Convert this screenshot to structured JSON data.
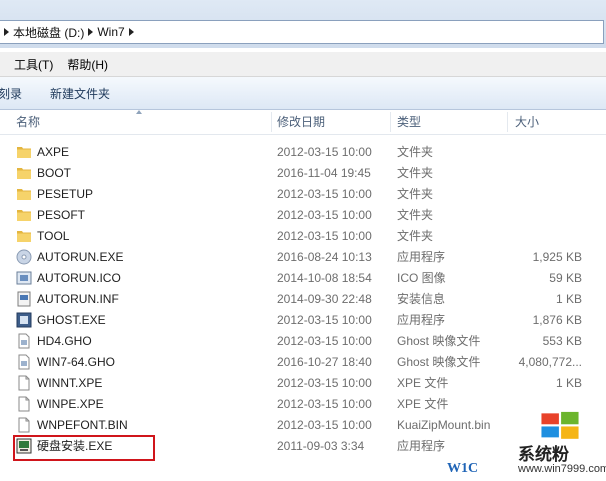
{
  "address": {
    "crumbs": [
      "本地磁盘 (D:)",
      "Win7"
    ]
  },
  "menu": [
    {
      "label": "工具(T)"
    },
    {
      "label": "帮助(H)"
    }
  ],
  "toolbar": {
    "burn_label": "刻录",
    "new_folder_label": "新建文件夹"
  },
  "columns": {
    "name": "名称",
    "date": "修改日期",
    "type": "类型",
    "size": "大小"
  },
  "files": [
    {
      "name": "AXPE",
      "date": "2012-03-15 10:00",
      "type": "文件夹",
      "size": "",
      "icon": "folder-icon"
    },
    {
      "name": "BOOT",
      "date": "2016-11-04 19:45",
      "type": "文件夹",
      "size": "",
      "icon": "folder-icon"
    },
    {
      "name": "PESETUP",
      "date": "2012-03-15 10:00",
      "type": "文件夹",
      "size": "",
      "icon": "folder-icon"
    },
    {
      "name": "PESOFT",
      "date": "2012-03-15 10:00",
      "type": "文件夹",
      "size": "",
      "icon": "folder-icon"
    },
    {
      "name": "TOOL",
      "date": "2012-03-15 10:00",
      "type": "文件夹",
      "size": "",
      "icon": "folder-icon"
    },
    {
      "name": "AUTORUN.EXE",
      "date": "2016-08-24 10:13",
      "type": "应用程序",
      "size": "1,925 KB",
      "icon": "disc-app-icon"
    },
    {
      "name": "AUTORUN.ICO",
      "date": "2014-10-08 18:54",
      "type": "ICO 图像",
      "size": "59 KB",
      "icon": "ico-image-icon"
    },
    {
      "name": "AUTORUN.INF",
      "date": "2014-09-30 22:48",
      "type": "安装信息",
      "size": "1 KB",
      "icon": "setup-info-icon"
    },
    {
      "name": "GHOST.EXE",
      "date": "2012-03-15 10:00",
      "type": "应用程序",
      "size": "1,876 KB",
      "icon": "ghost-app-icon"
    },
    {
      "name": "HD4.GHO",
      "date": "2012-03-15 10:00",
      "type": "Ghost 映像文件",
      "size": "553 KB",
      "icon": "ghost-image-icon"
    },
    {
      "name": "WIN7-64.GHO",
      "date": "2016-10-27 18:40",
      "type": "Ghost 映像文件",
      "size": "4,080,772...",
      "icon": "ghost-image-icon"
    },
    {
      "name": "WINNT.XPE",
      "date": "2012-03-15 10:00",
      "type": "XPE 文件",
      "size": "1 KB",
      "icon": "blank-file-icon"
    },
    {
      "name": "WINPE.XPE",
      "date": "2012-03-15 10:00",
      "type": "XPE 文件",
      "size": "",
      "icon": "blank-file-icon"
    },
    {
      "name": "WNPEFONT.BIN",
      "date": "2012-03-15 10:00",
      "type": "KuaiZipMount.bin",
      "size": "",
      "icon": "blank-file-icon"
    },
    {
      "name": "硬盘安装.EXE",
      "date": "2011-09-03 3:34",
      "type": "应用程序",
      "size": "",
      "icon": "installer-icon"
    }
  ],
  "watermark": {
    "brand": "系统粉",
    "url": "www.win7999.com",
    "left_text": "W1C"
  }
}
